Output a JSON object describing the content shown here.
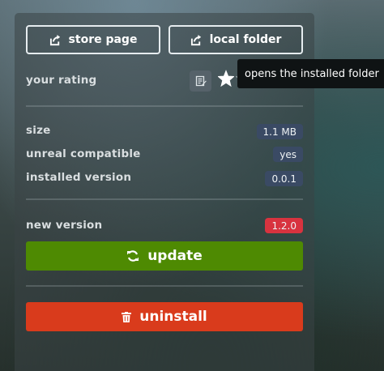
{
  "buttons": {
    "store_page": "store page",
    "local_folder": "local folder"
  },
  "rating": {
    "label": "your rating",
    "filled": 1,
    "total": 5
  },
  "tooltip": "opens the installed folder",
  "info": {
    "size_label": "size",
    "size_value": "1.1 MB",
    "unreal_label": "unreal compatible",
    "unreal_value": "yes",
    "installed_label": "installed version",
    "installed_value": "0.0.1"
  },
  "new_version": {
    "label": "new version",
    "value": "1.2.0"
  },
  "actions": {
    "update": "update",
    "uninstall": "uninstall"
  },
  "colors": {
    "badge_neutral": "#3a4a64",
    "badge_new": "#d8333f",
    "update": "#4e8a02",
    "uninstall": "#d93b1c"
  }
}
